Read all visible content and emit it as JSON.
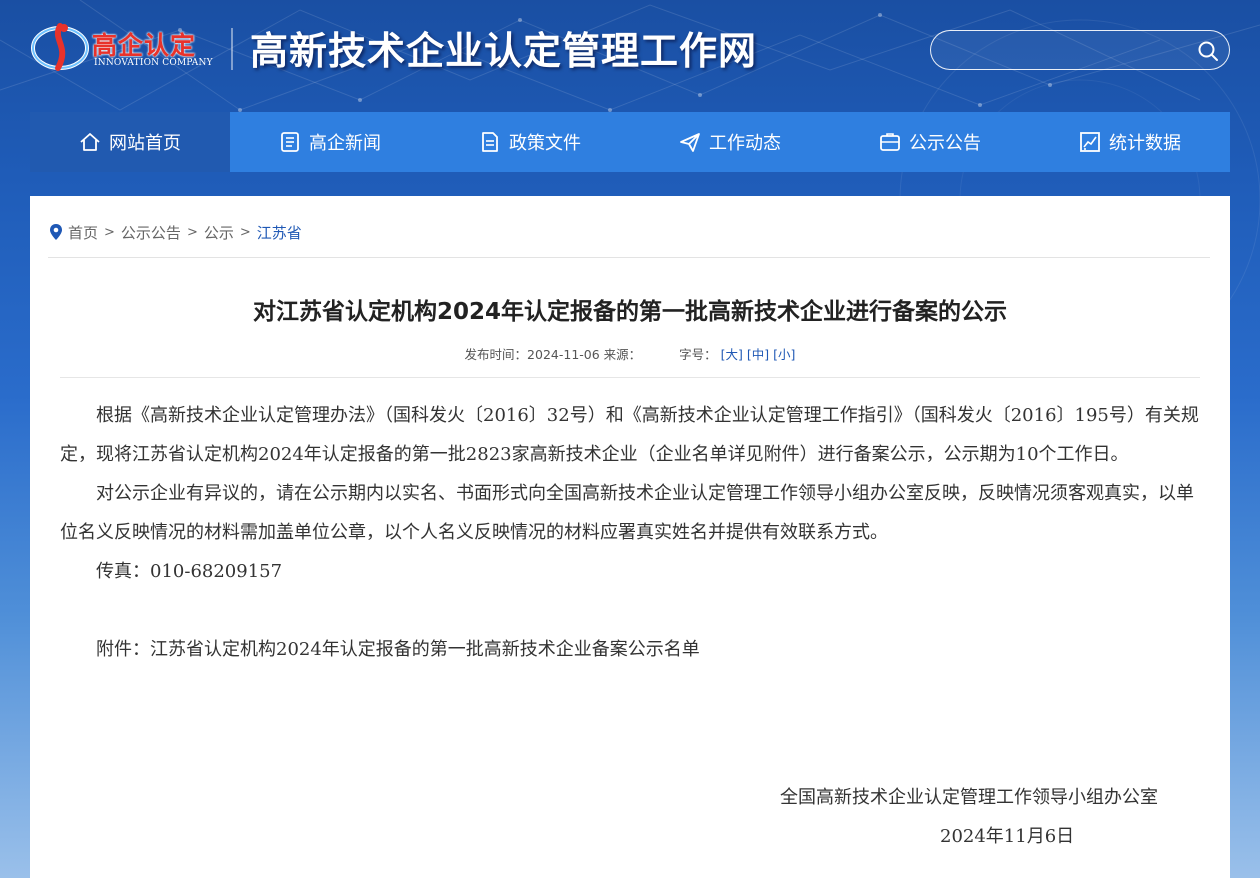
{
  "header": {
    "logo_cn": "高企认定",
    "logo_en": "INNOVATION COMPANY",
    "site_title": "高新技术企业认定管理工作网",
    "search_placeholder": ""
  },
  "nav": {
    "items": [
      {
        "label": "网站首页",
        "icon": "home-icon",
        "active": true
      },
      {
        "label": "高企新闻",
        "icon": "news-icon"
      },
      {
        "label": "政策文件",
        "icon": "document-icon"
      },
      {
        "label": "工作动态",
        "icon": "paper-plane-icon"
      },
      {
        "label": "公示公告",
        "icon": "announcement-icon"
      },
      {
        "label": "统计数据",
        "icon": "chart-icon"
      }
    ]
  },
  "breadcrumb": {
    "items": [
      "首页",
      "公示公告",
      "公示",
      "江苏省"
    ],
    "separator": ">"
  },
  "article": {
    "title": "对江苏省认定机构2024年认定报备的第一批高新技术企业进行备案的公示",
    "meta_published": "发布时间：2024-11-06 来源：",
    "meta_font_label": "字号：",
    "font_sizes": [
      "[大]",
      "[中]",
      "[小]"
    ],
    "paragraphs": [
      "根据《高新技术企业认定管理办法》（国科发火〔2016〕32号）和《高新技术企业认定管理工作指引》（国科发火〔2016〕195号）有关规定，现将江苏省认定机构2024年认定报备的第一批2823家高新技术企业（企业名单详见附件）进行备案公示，公示期为10个工作日。",
      "对公示企业有异议的，请在公示期内以实名、书面形式向全国高新技术企业认定管理工作领导小组办公室反映，反映情况须客观真实，以单位名义反映情况的材料需加盖单位公章，以个人名义反映情况的材料应署真实姓名并提供有效联系方式。",
      "传真：010-68209157"
    ],
    "attachment": "附件：江苏省认定机构2024年认定报备的第一批高新技术企业备案公示名单",
    "signature": "全国高新技术企业认定管理工作领导小组办公室",
    "date": "2024年11月6日"
  },
  "colors": {
    "nav_bg": "#2f7fe0",
    "nav_active": "#215ab0",
    "link_blue": "#1f58b5",
    "logo_red": "#e8322b"
  }
}
